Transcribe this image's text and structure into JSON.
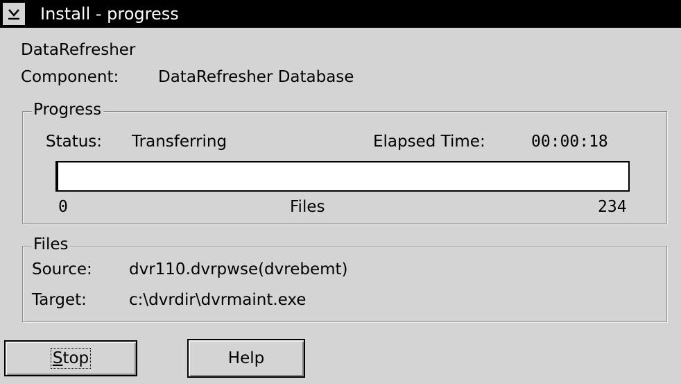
{
  "window": {
    "title": "Install - progress",
    "sysmenu_icon": "minimize-arrow-icon"
  },
  "product": "DataRefresher",
  "component": {
    "label": "Component:",
    "value": "DataRefresher Database"
  },
  "progress_group": {
    "legend": "Progress",
    "status_label": "Status:",
    "status_value": "Transferring",
    "elapsed_label": "Elapsed Time:",
    "elapsed_value": "00:00:18",
    "scale_min": "0",
    "scale_caption": "Files",
    "scale_max": "234",
    "progress_fraction": 0.0
  },
  "files_group": {
    "legend": "Files",
    "source_label": "Source:",
    "source_value": "dvr110.dvrpwse(dvrebemt)",
    "target_label": "Target:",
    "target_value": "c:\\dvrdir\\dvrmaint.exe"
  },
  "buttons": {
    "stop_first": "S",
    "stop_rest": "top",
    "help": "Help"
  }
}
